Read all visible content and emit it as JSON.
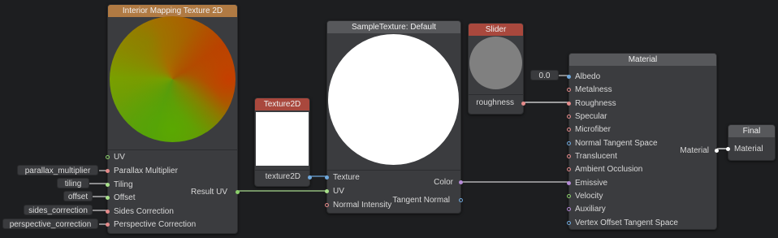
{
  "nodes": {
    "interior": {
      "title": "Interior Mapping Texture 2D",
      "inputs": [
        "UV",
        "Parallax Multiplier",
        "Tiling",
        "Offset",
        "Sides Correction",
        "Perspective Correction"
      ],
      "output": "Result UV"
    },
    "texture2d": {
      "title": "Texture2D",
      "output": "texture2D"
    },
    "sample": {
      "title": "SampleTexture: Default",
      "inputs": [
        "Texture",
        "UV",
        "Normal Intensity"
      ],
      "outputs": [
        "Color",
        "Tangent Normal"
      ]
    },
    "slider": {
      "title": "Slider",
      "output": "roughness"
    },
    "material": {
      "title": "Material",
      "inputs": [
        "Albedo",
        "Metalness",
        "Roughness",
        "Specular",
        "Microfiber",
        "Normal Tangent Space",
        "Translucent",
        "Ambient Occlusion",
        "Emissive",
        "Velocity",
        "Auxiliary",
        "Vertex Offset Tangent Space"
      ],
      "output": "Material"
    },
    "final": {
      "title": "Final",
      "input": "Material"
    }
  },
  "pills": {
    "parallax": "parallax_multiplier",
    "tiling": "tiling",
    "offset": "offset",
    "sides": "sides_correction",
    "perspective": "perspective_correction",
    "albedo_value": "0.0"
  },
  "colors": {
    "background": "#1d1e20",
    "node_body": "#3b3c3f",
    "header_orange": "#b07a43",
    "header_red": "#a9483d",
    "header_gray": "#57585b",
    "port_green": "#8bd06b",
    "port_pink": "#e58a8a",
    "port_blue": "#6fa8dc",
    "port_purple": "#b58ad6",
    "port_orange": "#e0995a",
    "wire_white": "#e8e8e8"
  }
}
